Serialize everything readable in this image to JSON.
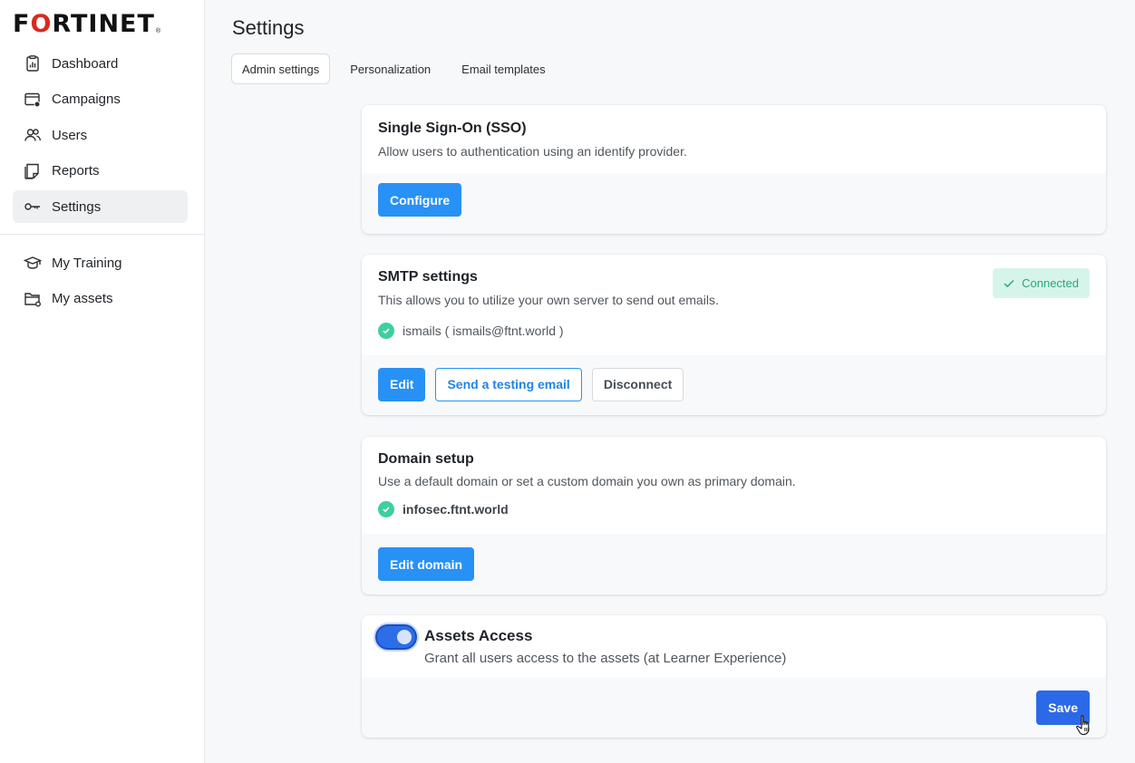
{
  "brand": {
    "logo_text_a": "F",
    "logo_text_o": "O",
    "logo_text_b": "RTINET",
    "logo_reg": "®",
    "accent": "#da291c"
  },
  "sidebar": {
    "items": [
      {
        "label": "Dashboard",
        "icon": "dashboard-icon"
      },
      {
        "label": "Campaigns",
        "icon": "campaigns-icon"
      },
      {
        "label": "Users",
        "icon": "users-icon"
      },
      {
        "label": "Reports",
        "icon": "reports-icon"
      },
      {
        "label": "Settings",
        "icon": "key-icon",
        "active": true
      }
    ],
    "secondary": [
      {
        "label": "My Training",
        "icon": "graduation-cap-icon"
      },
      {
        "label": "My assets",
        "icon": "folder-icon"
      }
    ]
  },
  "page": {
    "title": "Settings"
  },
  "tabs": [
    {
      "label": "Admin settings",
      "active": true
    },
    {
      "label": "Personalization"
    },
    {
      "label": "Email templates"
    }
  ],
  "sso": {
    "title": "Single Sign-On (SSO)",
    "description": "Allow users to authentication using an identify provider.",
    "configure_label": "Configure"
  },
  "smtp": {
    "title": "SMTP settings",
    "description": "This allows you to utilize your own server to send out emails.",
    "status_badge": "Connected",
    "account": "ismails ( ismails@ftnt.world )",
    "edit_label": "Edit",
    "test_label": "Send a testing email",
    "disconnect_label": "Disconnect"
  },
  "domain": {
    "title": "Domain setup",
    "description": "Use a default domain or set a custom domain you own as primary domain.",
    "current": "infosec.ftnt.world",
    "edit_label": "Edit domain"
  },
  "assets": {
    "title": "Assets Access",
    "description": "Grant all users access to the assets (at Learner Experience)",
    "enabled": true,
    "save_label": "Save"
  },
  "colors": {
    "primary": "#2891f5",
    "save": "#2c69e8",
    "success": "#3ecf9e",
    "badge_bg": "#d6f5ea"
  }
}
